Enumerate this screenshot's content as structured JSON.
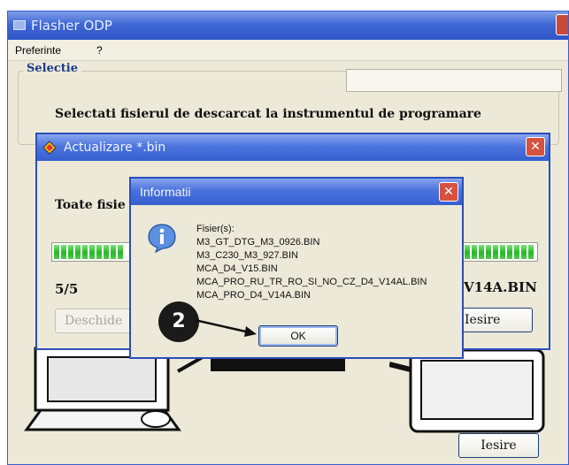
{
  "main_window": {
    "title": "Flasher ODP",
    "menu": [
      {
        "label": "Preferinte"
      },
      {
        "label": "?"
      }
    ],
    "group_label": "Selectie",
    "instruction": "Selectati fisierul de descarcat la instrumentul de programare",
    "exit_button": "Iesire"
  },
  "update_dialog": {
    "title": "Actualizare *.bin",
    "message": "Toate fisie",
    "counter": "5/5",
    "filename_tail": "V14A.BIN",
    "open_button": "Deschide",
    "exit_button": "Iesire",
    "progress_fraction": 1.0
  },
  "info_dialog": {
    "title": "Informatii",
    "heading": "Fisier(s):",
    "files": [
      "M3_GT_DTG_M3_0926.BIN",
      "M3_C230_M3_927.BIN",
      "MCA_D4_V15.BIN",
      "MCA_PRO_RU_TR_RO_SI_NO_CZ_D4_V14AL.BIN",
      "MCA_PRO_D4_V14A.BIN"
    ],
    "ok_button": "OK",
    "icon": "information-icon"
  },
  "annotation": {
    "step": "2"
  },
  "colors": {
    "titlebar": "#3f68d6",
    "window_bg": "#ece9d8",
    "progress": "#28b528",
    "close": "#d6523f"
  }
}
